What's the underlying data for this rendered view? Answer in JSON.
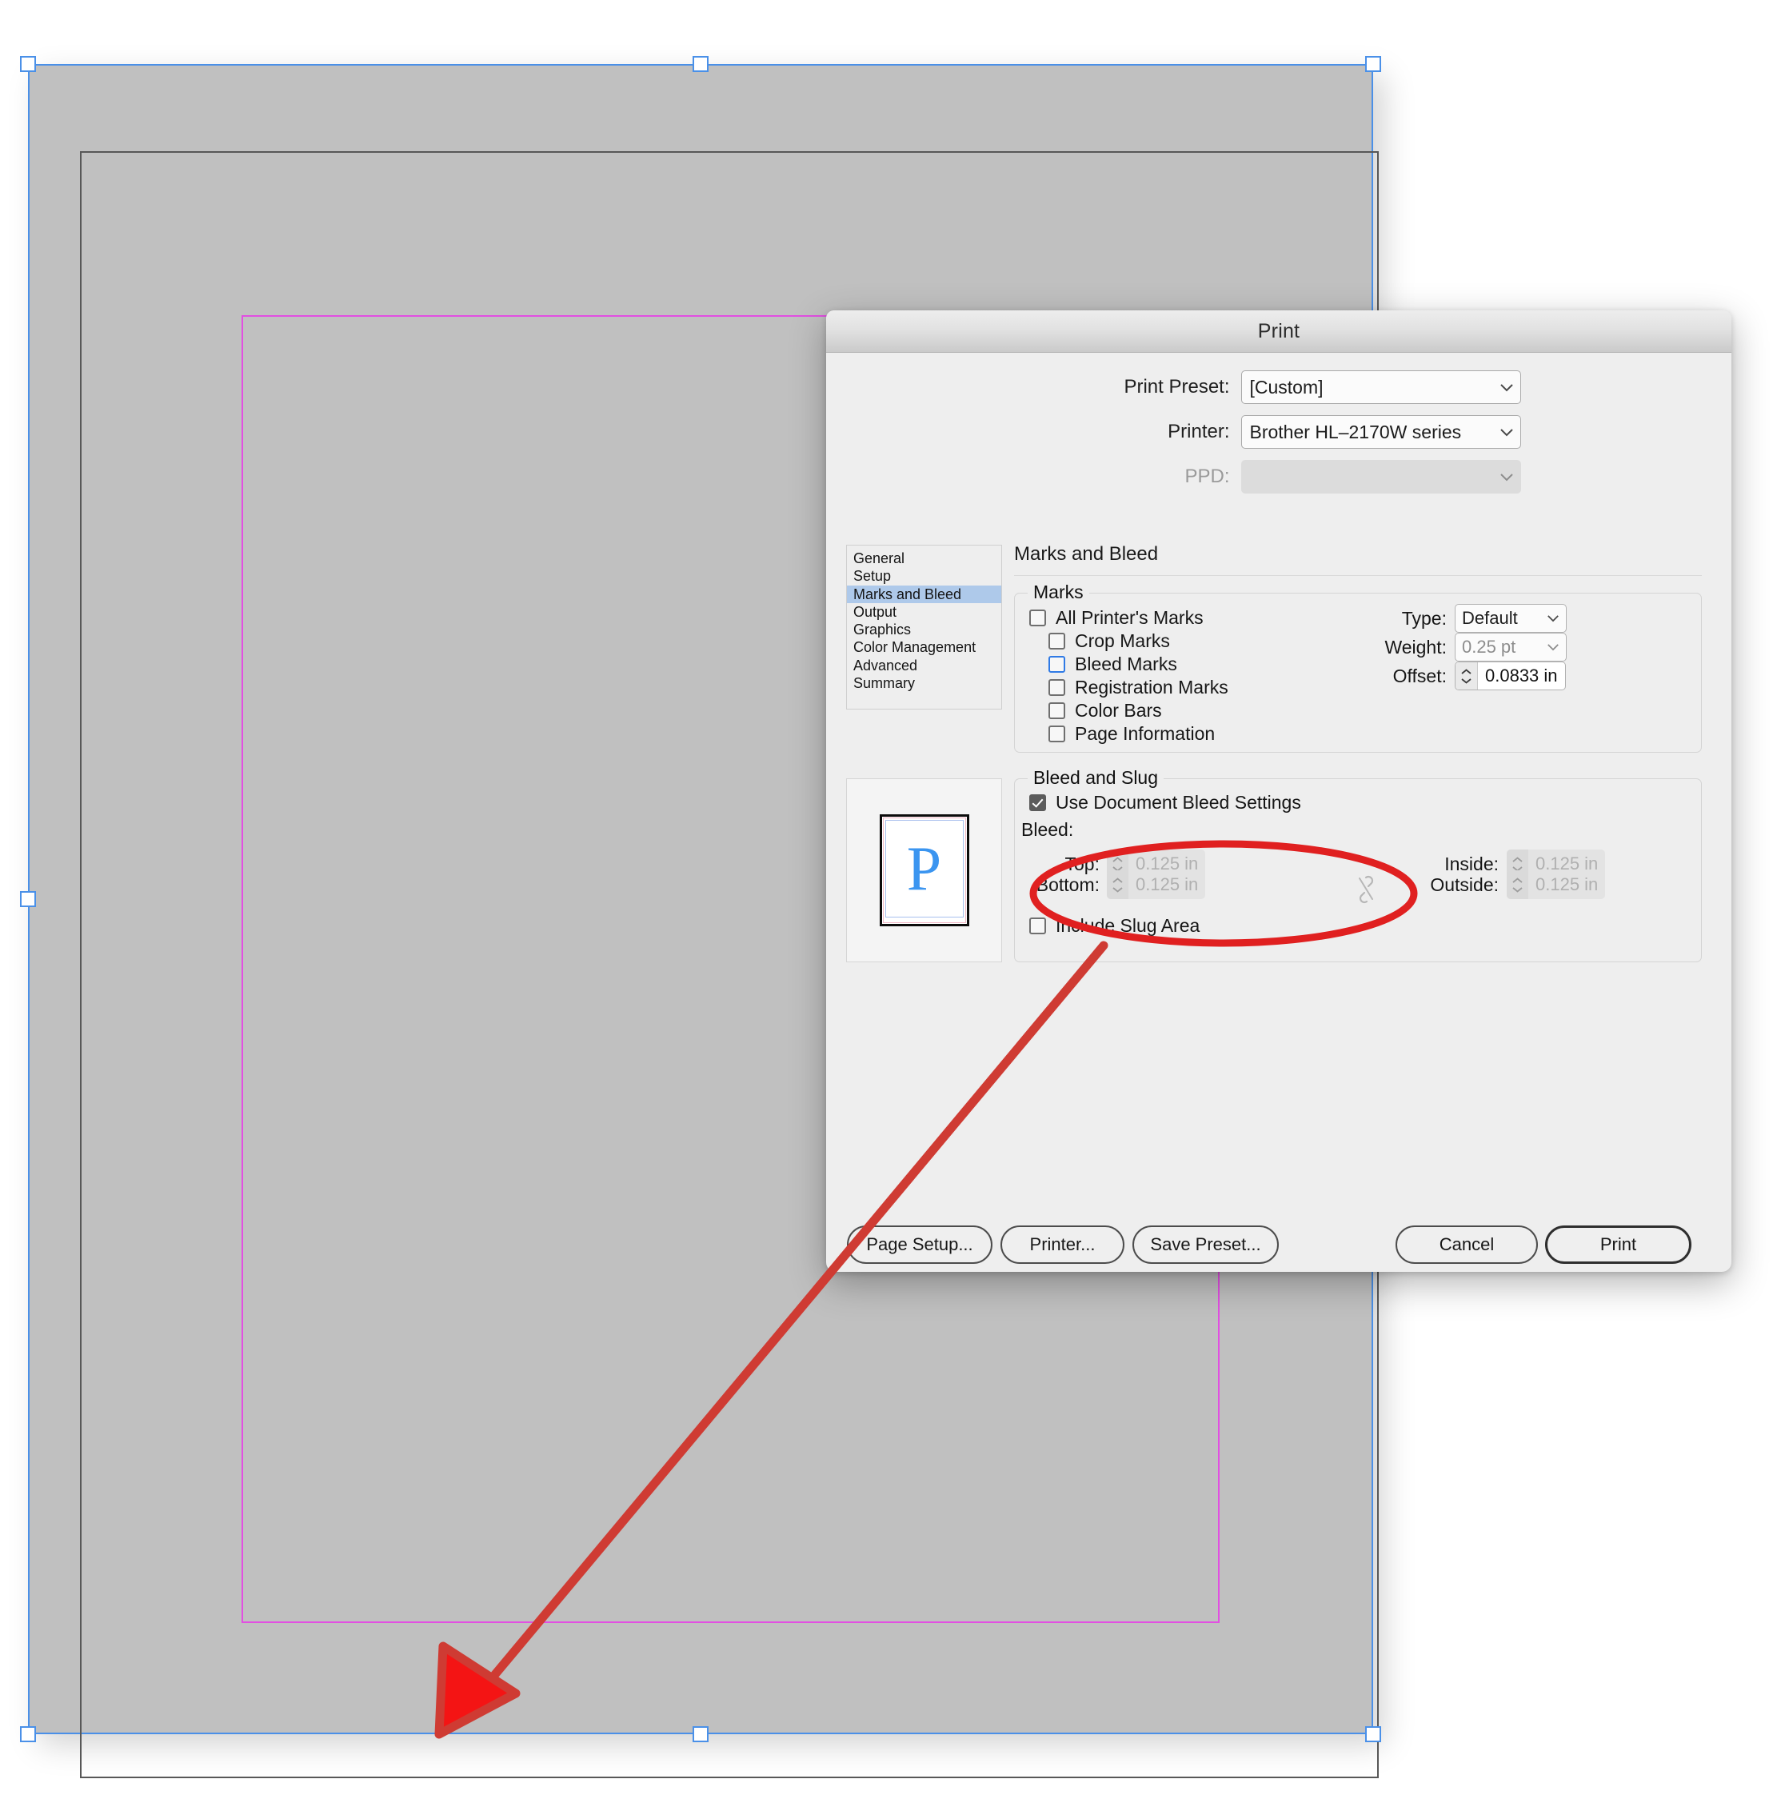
{
  "canvas": {
    "description": "InDesign document canvas with selected page spread",
    "page_fill_color": "#c0c0c0",
    "selection_color": "#4a90e8",
    "margin_guide_color": "#e24fe2",
    "page_edge_color": "#575757"
  },
  "dialog": {
    "title": "Print",
    "top_fields": [
      {
        "label": "Print Preset:",
        "value": "[Custom]",
        "disabled": false
      },
      {
        "label": "Printer:",
        "value": "Brother HL–2170W series",
        "disabled": false
      },
      {
        "label": "PPD:",
        "value": "",
        "disabled": true
      }
    ],
    "sidebar": {
      "items": [
        {
          "label": "General",
          "selected": false
        },
        {
          "label": "Setup",
          "selected": false
        },
        {
          "label": "Marks and Bleed",
          "selected": true
        },
        {
          "label": "Output",
          "selected": false
        },
        {
          "label": "Graphics",
          "selected": false
        },
        {
          "label": "Color Management",
          "selected": false
        },
        {
          "label": "Advanced",
          "selected": false
        },
        {
          "label": "Summary",
          "selected": false
        }
      ],
      "selected_color": "#aec9ea"
    },
    "panel": {
      "title": "Marks and Bleed",
      "marks": {
        "legend": "Marks",
        "checkboxes": [
          {
            "label": "All Printer's Marks",
            "checked": false,
            "focused": false,
            "indent": 0
          },
          {
            "label": "Crop Marks",
            "checked": false,
            "focused": false,
            "indent": 1
          },
          {
            "label": "Bleed Marks",
            "checked": false,
            "focused": true,
            "indent": 1
          },
          {
            "label": "Registration Marks",
            "checked": false,
            "focused": false,
            "indent": 1
          },
          {
            "label": "Color Bars",
            "checked": false,
            "focused": false,
            "indent": 1
          },
          {
            "label": "Page Information",
            "checked": false,
            "focused": false,
            "indent": 1
          }
        ],
        "type": {
          "label": "Type:",
          "value": "Default",
          "dim": false
        },
        "weight": {
          "label": "Weight:",
          "value": "0.25 pt",
          "dim": true
        },
        "offset": {
          "label": "Offset:",
          "value": "0.0833 in",
          "disabled": false
        }
      },
      "bleed_and_slug": {
        "legend": "Bleed and Slug",
        "use_document_bleed": {
          "label": "Use Document Bleed Settings",
          "checked": true
        },
        "bleed_heading": "Bleed:",
        "fields": [
          {
            "label": "Top:",
            "value": "0.125 in",
            "disabled": true
          },
          {
            "label": "Bottom:",
            "value": "0.125 in",
            "disabled": true
          },
          {
            "label": "Inside:",
            "value": "0.125 in",
            "disabled": true
          },
          {
            "label": "Outside:",
            "value": "0.125 in",
            "disabled": true
          }
        ],
        "link_icon": "broken-chain-link-icon",
        "include_slug": {
          "label": "Include Slug Area",
          "checked": false
        }
      },
      "preview": {
        "letter": "P",
        "letter_color": "#3b95f0"
      }
    },
    "buttons": [
      {
        "label": "Page Setup...",
        "default": false
      },
      {
        "label": "Printer...",
        "default": false
      },
      {
        "label": "Save Preset...",
        "default": false
      },
      {
        "label": "Cancel",
        "default": false
      },
      {
        "label": "Print",
        "default": true
      }
    ]
  },
  "annotation": {
    "color": "#d32f2f",
    "ellipse_target": "Use Document Bleed Settings",
    "arrow_points_to": "document bleed area at bottom of page"
  }
}
